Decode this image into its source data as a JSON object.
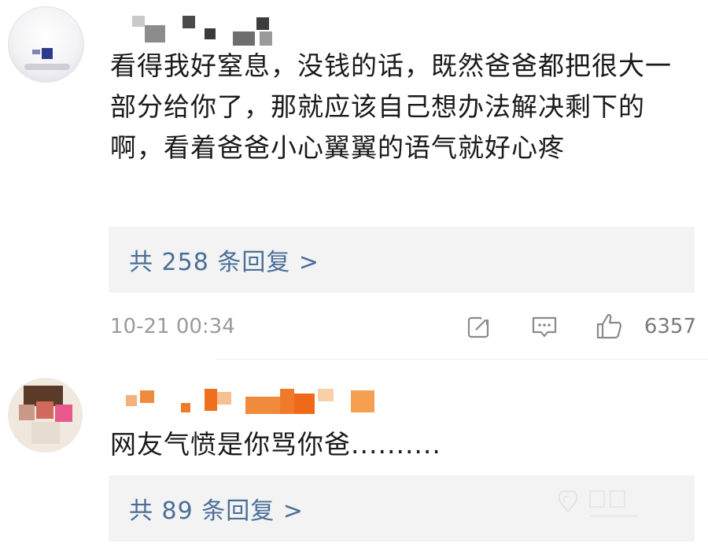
{
  "comments": [
    {
      "text": "看得我好窒息，没钱的话，既然爸爸都把很大一部分给你了，那就应该自己想办法解决剩下的啊，看着爸爸小心翼翼的语气就好心疼",
      "replies_label": "共 258 条回复 >",
      "time": "10-21 00:34",
      "likes": "6357"
    },
    {
      "text": "网友气愤是你骂你爸..........",
      "replies_label": "共 89 条回复 >"
    }
  ],
  "icons": {
    "share": "share-icon",
    "comment": "comment-icon",
    "like": "thumbs-up-icon"
  },
  "colors": {
    "link_blue": "#4a6e98",
    "meta_gray": "#9b9b9b",
    "reply_bg": "#f3f3f3"
  }
}
